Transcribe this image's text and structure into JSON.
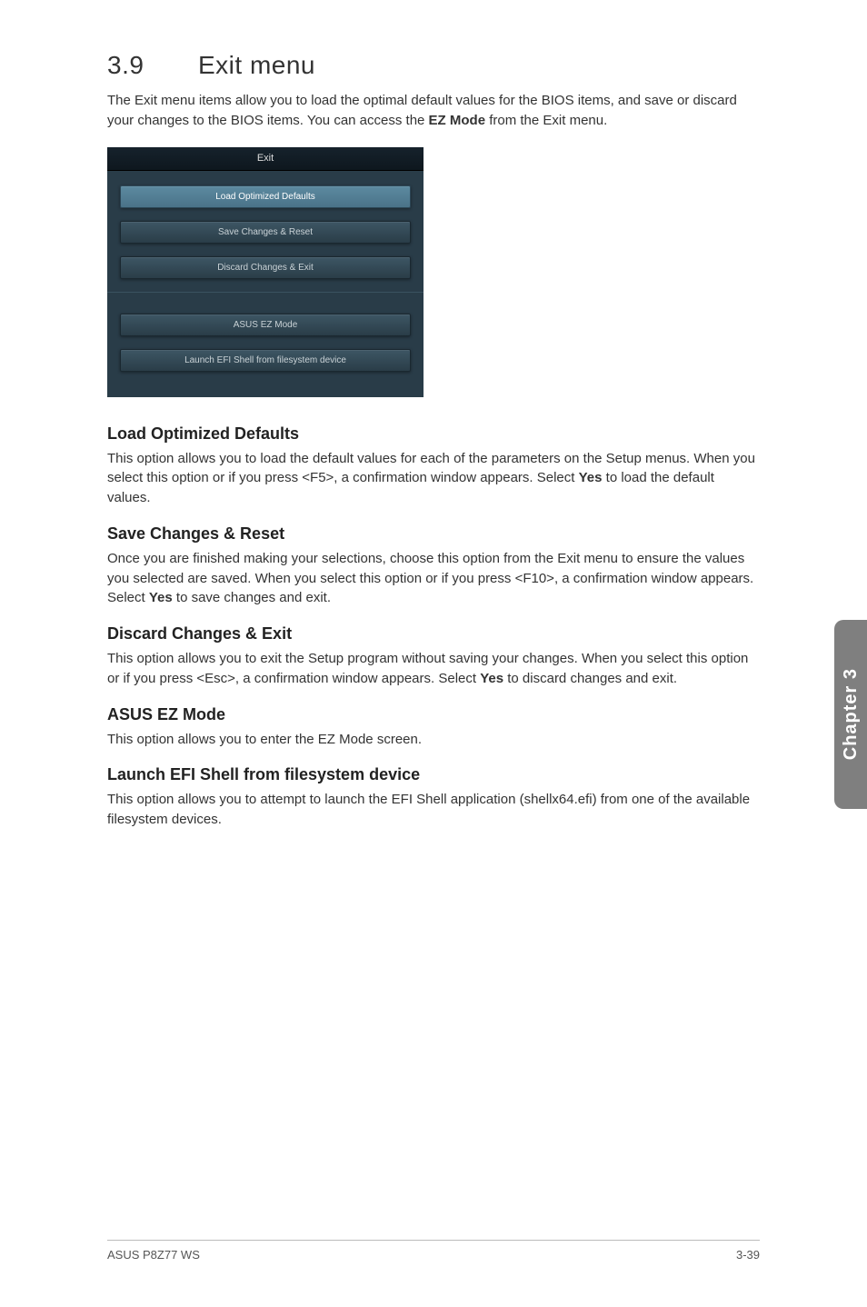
{
  "section": {
    "number": "3.9",
    "title": "Exit menu",
    "intro_parts": [
      "The Exit menu items allow you to load the optimal default values for the BIOS items, and save or discard your changes to the BIOS items. You can access the ",
      "EZ Mode",
      " from the Exit menu."
    ]
  },
  "bios": {
    "header": "Exit",
    "buttons_top": [
      {
        "label": "Load Optimized Defaults",
        "selected": true
      },
      {
        "label": "Save Changes & Reset",
        "selected": false
      },
      {
        "label": "Discard Changes & Exit",
        "selected": false
      }
    ],
    "buttons_bottom": [
      {
        "label": "ASUS EZ Mode",
        "selected": false
      },
      {
        "label": "Launch EFI Shell from filesystem device",
        "selected": false
      }
    ]
  },
  "items": [
    {
      "heading": "Load Optimized Defaults",
      "body_parts": [
        "This option allows you to load the default values for each of the parameters on the Setup menus. When you select this option or if you press <F5>, a confirmation window appears. Select ",
        "Yes",
        " to load the default values."
      ]
    },
    {
      "heading": "Save Changes & Reset",
      "body_parts": [
        "Once you are finished making your selections, choose this option from the Exit menu to ensure the values you selected are saved. When you select this option or if you press <F10>, a confirmation window appears. Select ",
        "Yes",
        " to save changes and exit."
      ]
    },
    {
      "heading": "Discard Changes & Exit",
      "body_parts": [
        "This option allows you to exit the Setup program without saving your changes. When you select this option or if you press <Esc>, a confirmation window appears. Select ",
        "Yes",
        " to discard changes and exit."
      ]
    },
    {
      "heading": "ASUS EZ Mode",
      "body_parts": [
        "This option allows you to enter the EZ Mode screen.",
        "",
        ""
      ]
    },
    {
      "heading": "Launch EFI Shell from filesystem device",
      "body_parts": [
        "This option allows you to attempt to launch the EFI Shell application (shellx64.efi) from one of the available filesystem devices.",
        "",
        ""
      ]
    }
  ],
  "side_tab": "Chapter 3",
  "footer": {
    "left": "ASUS P8Z77 WS",
    "right": "3-39"
  }
}
